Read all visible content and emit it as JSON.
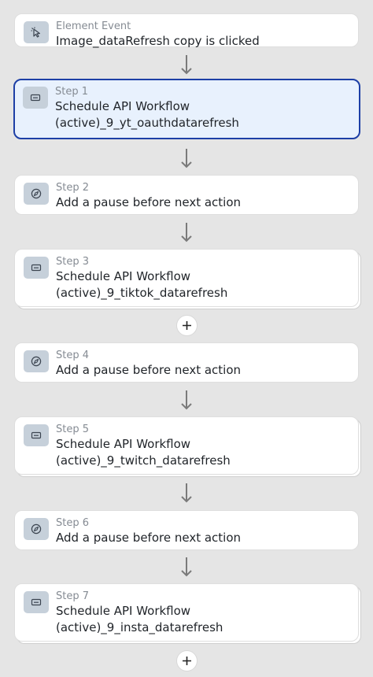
{
  "trigger": {
    "kicker": "Element Event",
    "title": "Image_dataRefresh copy is clicked",
    "icon": "cursor-click-icon"
  },
  "steps": [
    {
      "kicker": "Step 1",
      "line1": "Schedule API Workflow",
      "line2": "(active)_9_yt_oauthdatarefresh",
      "icon": "api-workflow-icon",
      "selected": true
    },
    {
      "kicker": "Step 2",
      "line1": "Add a pause before next action",
      "icon": "compass-icon"
    },
    {
      "kicker": "Step 3",
      "line1": "Schedule API Workflow",
      "line2": "(active)_9_tiktok_datarefresh",
      "icon": "api-workflow-icon"
    },
    {
      "kicker": "Step 4",
      "line1": "Add a pause before next action",
      "icon": "compass-icon"
    },
    {
      "kicker": "Step 5",
      "line1": "Schedule API Workflow",
      "line2": "(active)_9_twitch_datarefresh",
      "icon": "api-workflow-icon"
    },
    {
      "kicker": "Step 6",
      "line1": "Add a pause before next action",
      "icon": "compass-icon"
    },
    {
      "kicker": "Step 7",
      "line1": "Schedule API Workflow",
      "line2": "(active)_9_insta_datarefresh",
      "icon": "api-workflow-icon"
    }
  ],
  "colors": {
    "selected_border": "#1d3fa6",
    "selected_bg": "#e8f1fd",
    "icon_bg": "#c6d0da",
    "arrow": "#7a7a7a"
  }
}
